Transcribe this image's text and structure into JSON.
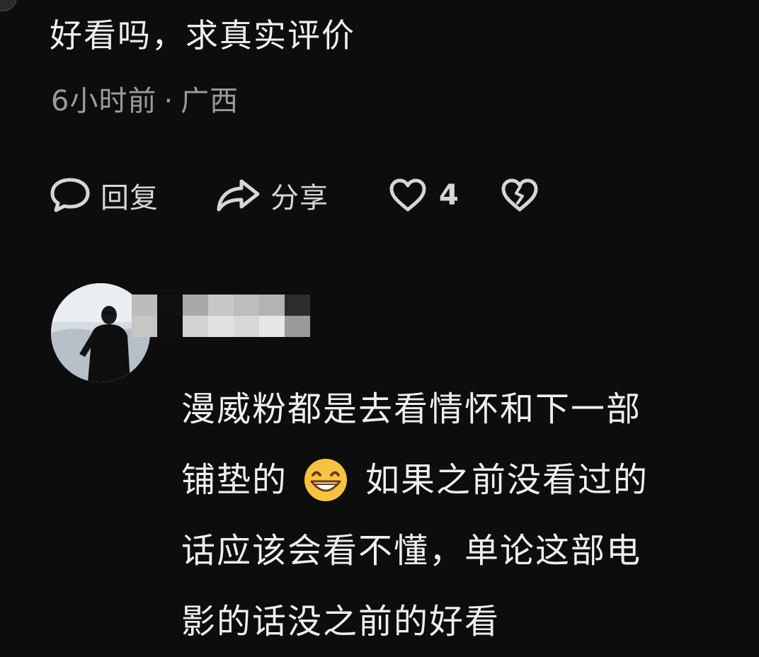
{
  "comment": {
    "text": "好看吗，求真实评价",
    "time": "6小时前",
    "separator": "·",
    "location": "广西"
  },
  "actions": {
    "reply_label": "回复",
    "share_label": "分享",
    "like_count": "4"
  },
  "reply": {
    "lines": {
      "l1": "漫威粉都是去看情怀和下一部",
      "l2a": "铺垫的",
      "l2b": "如果之前没看过的",
      "l3": "话应该会看不懂，单论这部电",
      "l4": "影的话没之前的好看"
    },
    "emoji": "grinning-face-emoji"
  },
  "colors": {
    "background": "#0d0d0e",
    "text": "#f0f0f0",
    "meta_text": "#9b9b9b",
    "icon": "#d6d6d6",
    "emoji_face": "#f7c244"
  }
}
